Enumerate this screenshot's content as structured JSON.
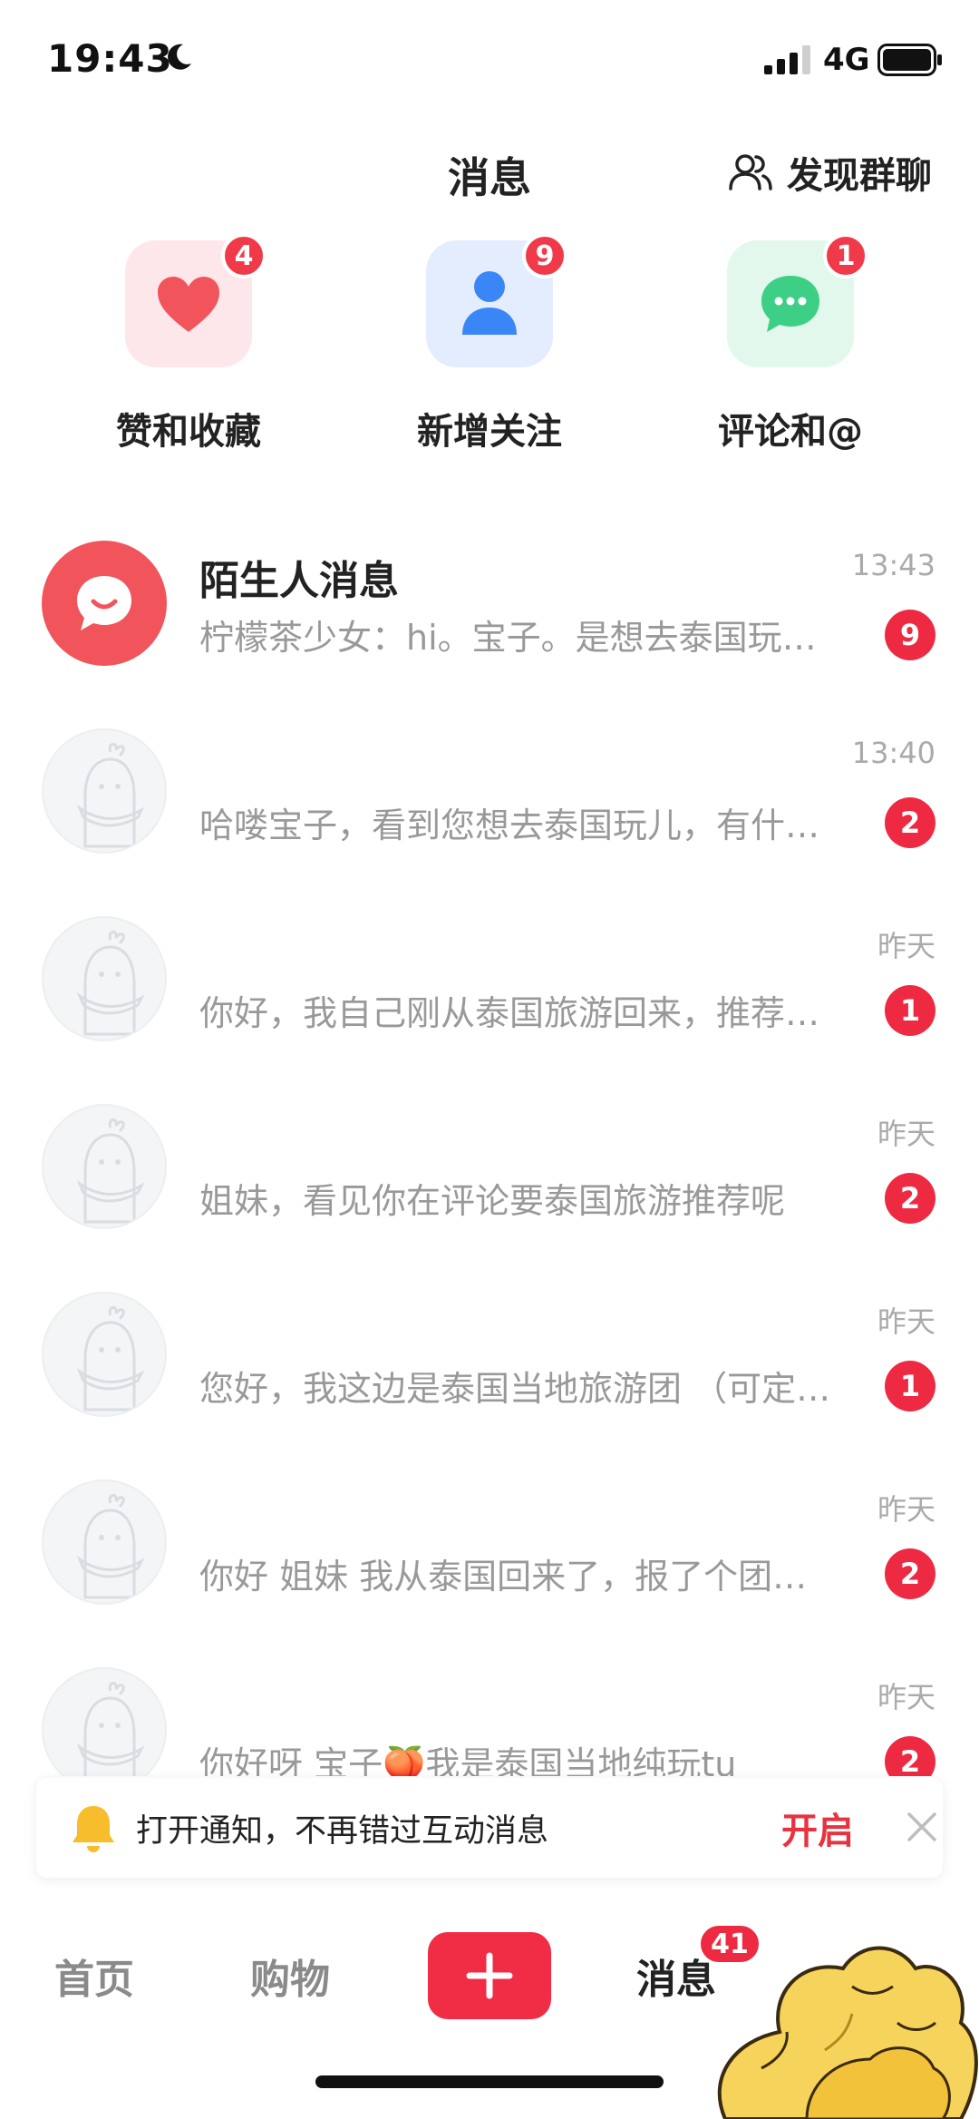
{
  "status_bar": {
    "time": "19:43",
    "network": "4G"
  },
  "header": {
    "title": "消息",
    "discover_label": "发现群聊"
  },
  "quick_actions": [
    {
      "label": "赞和收藏",
      "badge": "4",
      "icon": "heart-icon",
      "color": "#f2545c"
    },
    {
      "label": "新增关注",
      "badge": "9",
      "icon": "person-icon",
      "color": "#3a86f7"
    },
    {
      "label": "评论和@",
      "badge": "1",
      "icon": "chat-bubble-icon",
      "color": "#3ccf85"
    }
  ],
  "conversations": [
    {
      "name": "陌生人消息",
      "time": "13:43",
      "preview": "柠檬茶少女：hi。宝子。是想去泰国玩儿吗？",
      "badge": "9"
    },
    {
      "name": "",
      "time": "13:40",
      "preview": "哈喽宝子，看到您想去泰国玩儿，有什么需要",
      "badge": "2"
    },
    {
      "name": "",
      "time": "昨天",
      "preview": "你好，我自己刚从泰国旅游回来，推荐给你",
      "badge": "1"
    },
    {
      "name": "",
      "time": "昨天",
      "preview": "姐妹，看见你在评论要泰国旅游推荐呢",
      "badge": "2"
    },
    {
      "name": "",
      "time": "昨天",
      "preview": "您好，我这边是泰国当地旅游团 （可定制）",
      "badge": "1"
    },
    {
      "name": "",
      "time": "昨天",
      "preview": "你好 姐妹 我从泰国回来了，报了个团很不错",
      "badge": "2"
    },
    {
      "name": "",
      "time": "昨天",
      "preview": "你好呀 宝子🍑我是泰国当地纯玩tu",
      "badge": "2"
    }
  ],
  "notification": {
    "text": "打开通知，不再错过互动消息",
    "action": "开启"
  },
  "tabbar": {
    "home": "首页",
    "shop": "购物",
    "messages": "消息",
    "messages_badge": "41"
  },
  "colors": {
    "accent": "#ee2a42",
    "stranger_avatar": "#f2545c"
  }
}
